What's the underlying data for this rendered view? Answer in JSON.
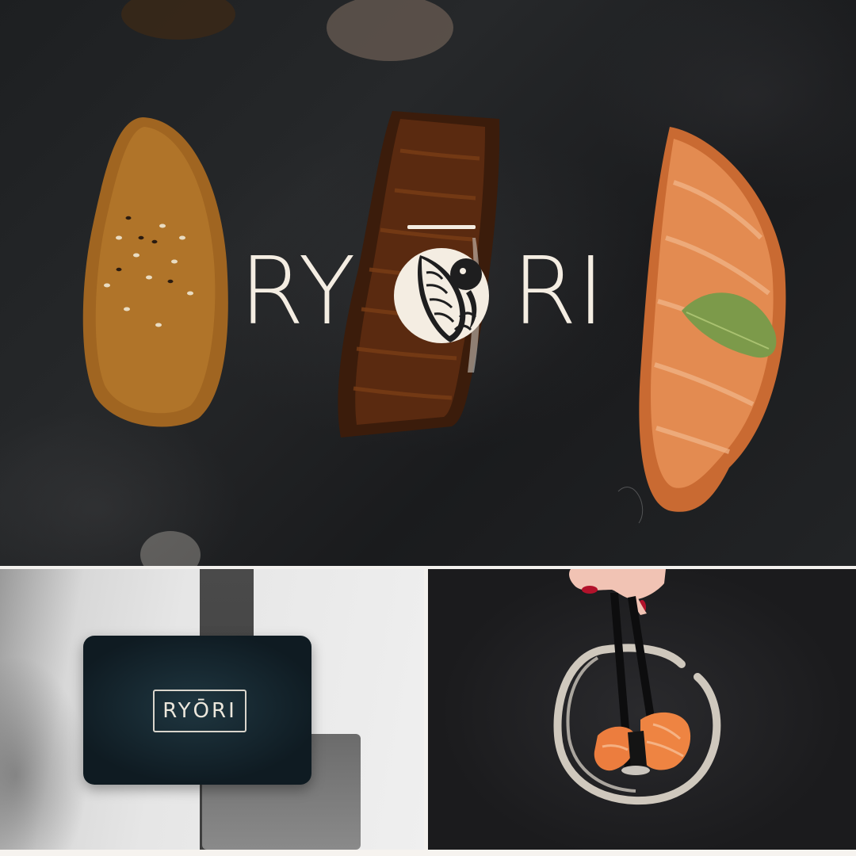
{
  "brand": {
    "wordmark": "RYŌRI",
    "letters_left": "RY",
    "letters_right": "RI"
  },
  "panels": {
    "hero": {
      "subject": "sushi-nigiri-on-slate"
    },
    "card": {
      "subject": "business-card"
    },
    "chopsticks": {
      "subject": "chopsticks-holding-sushi"
    }
  },
  "colors": {
    "logo_cream": "#f4ede2",
    "slate": "#1f2123",
    "card_teal": "#132530",
    "salmon": "#f08a4a"
  },
  "icons": [
    "koi-fish-circle-icon",
    "enso-circle-icon"
  ]
}
